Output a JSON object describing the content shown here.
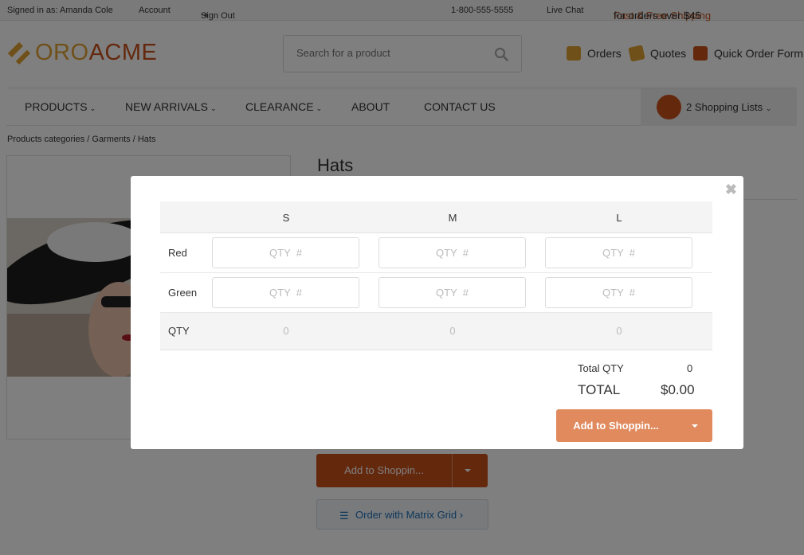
{
  "topbar": {
    "signed_in": "Signed in as: Amanda Cole",
    "account": "Account",
    "sign_out": "Sign Out",
    "phone": "1-800-555-5555",
    "live_chat": "Live Chat",
    "promo_highlight": "Fast & Free Shipping",
    "promo_rest": " for orders over $45"
  },
  "header": {
    "logo_oro": "ORO",
    "logo_acme": "ACME",
    "search_placeholder": "Search for a product",
    "orders": "Orders",
    "quotes": "Quotes",
    "quick_order": "Quick Order Form"
  },
  "nav": {
    "products": "PRODUCTS",
    "new_arrivals": "NEW ARRIVALS",
    "clearance": "CLEARANCE",
    "about": "ABOUT",
    "contact": "CONTACT US",
    "shopping_lists": "2 Shopping Lists"
  },
  "breadcrumb": "Products categories / Garments / Hats",
  "product": {
    "title": "Hats",
    "add_button": "Add to Shoppin...",
    "matrix_button": "Order with Matrix Grid ›"
  },
  "matrix": {
    "columns": [
      "S",
      "M",
      "L"
    ],
    "rows": [
      {
        "label": "Red",
        "values": [
          "",
          "",
          ""
        ]
      },
      {
        "label": "Green",
        "values": [
          "",
          "",
          ""
        ]
      }
    ],
    "qty_placeholder": "QTY  #",
    "total_row_label": "QTY",
    "column_totals": [
      "0",
      "0",
      "0"
    ],
    "total_qty_label": "Total QTY",
    "total_qty_value": "0",
    "total_label": "TOTAL",
    "total_value": "$0.00",
    "add_button": "Add to Shoppin..."
  },
  "colors": {
    "brand": "#c8511b",
    "brand_light": "#e08a5e",
    "logo_gold": "#e0a032",
    "link_blue": "#1f6fb5"
  }
}
